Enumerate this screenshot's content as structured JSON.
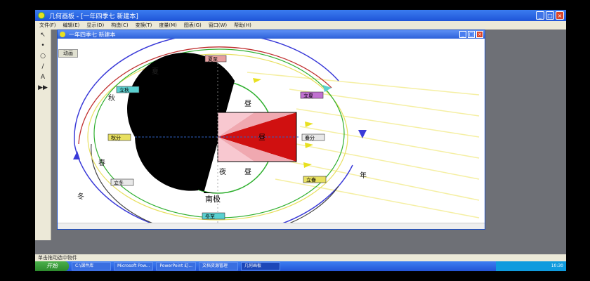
{
  "app": {
    "title": "几何画板 - [一年四季七 新建本]"
  },
  "menu": [
    "文件(F)",
    "编辑(E)",
    "显示(D)",
    "构造(C)",
    "变换(T)",
    "度量(M)",
    "图表(G)",
    "窗口(W)",
    "帮助(H)"
  ],
  "tools": [
    "↖",
    "•",
    "○",
    "/",
    "A",
    "▶▶"
  ],
  "doc": {
    "title": "一年四季七 新建本",
    "animate_label": "动画"
  },
  "diagram": {
    "season_summer": "夏",
    "season_autumn": "秋",
    "season_winter": "冬",
    "season_spring": "春",
    "year_label": "年",
    "label_day_top": "昼",
    "label_day_mid": "昼",
    "label_night1": "夜",
    "label_night2": "昼",
    "south_pole": "南极",
    "tags": {
      "top": "夏至",
      "upper_left": "立秋",
      "left": "秋分",
      "lower_left": "立冬",
      "right_top": "立夏",
      "right_mid": "春分",
      "right_low": "立春",
      "bottom": "冬至"
    }
  },
  "status": {
    "text": "单击拖动选中物件"
  },
  "taskbar": {
    "start": "开始",
    "items": [
      "C:\\课件库",
      "Microsoft Pow...",
      "PowerPoint 幻...",
      "文档资源管理",
      "几何画板"
    ],
    "tray_time": "10:30"
  },
  "colors": {
    "tag_pink": "#e8a0a0",
    "tag_cyan": "#5ad0d0",
    "tag_red": "#d02020",
    "orbit_blue": "#3a3ad8",
    "orbit_red": "#c03030",
    "orbit_green": "#30b030",
    "sun_yellow": "#f0e040"
  }
}
